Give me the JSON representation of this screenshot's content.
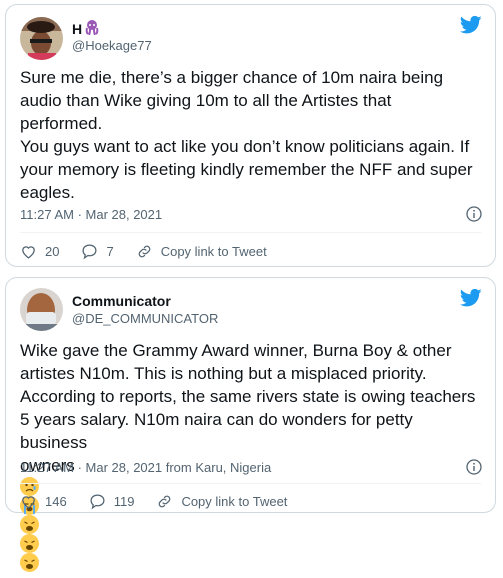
{
  "tweets": [
    {
      "display_name": "H",
      "handle": "@Hoekage77",
      "lines": [
        "Sure me die, there’s a bigger chance of 10m naira being",
        "audio than Wike giving 10m to all the Artistes that",
        "performed.",
        "You guys want to act like you don’t know politicians again. If",
        "your memory is fleeting kindly remember the NFF and super",
        "eagles."
      ],
      "timestamp": "11:27 AM · Mar 28, 2021",
      "likes": "20",
      "replies": "7",
      "copy_link": "Copy link to Tweet",
      "name_emoji": "purple-octopus-emoji"
    },
    {
      "display_name": "Communicator",
      "handle": "@DE_COMMUNICATOR",
      "lines": [
        "Wike gave the Grammy Award winner, Burna Boy & other",
        "artistes N10m. This is nothing but a misplaced priority.",
        "According to reports, the same rivers state is owing teachers",
        "5 years salary. N10m naira can do wonders for petty business",
        "owners"
      ],
      "emojis": [
        "sad-relieved-face-emoji",
        "loudly-crying-face-emoji",
        "weary-face-emoji",
        "weary-face-emoji",
        "weary-face-emoji"
      ],
      "timestamp": "11:27 AM · Mar 28, 2021 from Karu, Nigeria",
      "likes": "146",
      "replies": "119",
      "copy_link": "Copy link to Tweet"
    }
  ],
  "colors": {
    "twitter_blue": "#1d9bf0",
    "text": "#0f1419",
    "muted": "#536471",
    "border": "#cfd9de"
  }
}
